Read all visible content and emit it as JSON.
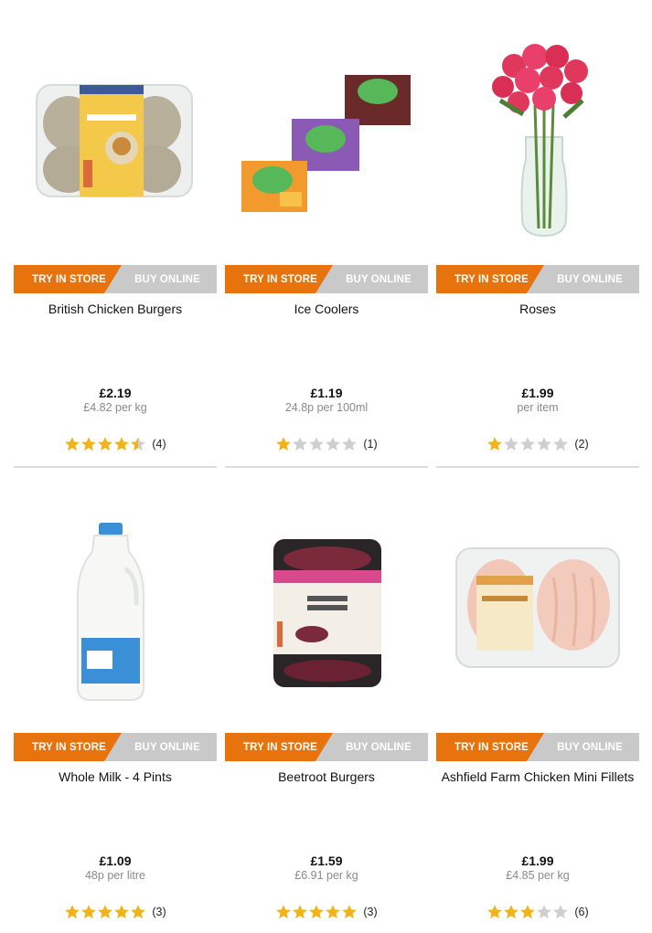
{
  "products": [
    {
      "name": "British Chicken Burgers",
      "price": "£2.19",
      "unit_price": "£4.82 per kg",
      "rating": 4.5,
      "reviews": "(4)",
      "image_icon": "chicken-burgers-pack-icon",
      "try_label": "TRY IN STORE",
      "buy_label": "BUY ONLINE"
    },
    {
      "name": "Ice Coolers",
      "price": "£1.19",
      "unit_price": "24.8p per 100ml",
      "rating": 1,
      "reviews": "(1)",
      "image_icon": "ice-coolers-boxes-icon",
      "try_label": "TRY IN STORE",
      "buy_label": "BUY ONLINE"
    },
    {
      "name": "Roses",
      "price": "£1.99",
      "unit_price": "per item",
      "rating": 1,
      "reviews": "(2)",
      "image_icon": "roses-vase-icon",
      "try_label": "TRY IN STORE",
      "buy_label": "BUY ONLINE"
    },
    {
      "name": "Whole Milk - 4 Pints",
      "price": "£1.09",
      "unit_price": "48p per litre",
      "rating": 5,
      "reviews": "(3)",
      "image_icon": "milk-bottle-icon",
      "try_label": "TRY IN STORE",
      "buy_label": "BUY ONLINE"
    },
    {
      "name": "Beetroot Burgers",
      "price": "£1.59",
      "unit_price": "£6.91 per kg",
      "rating": 5,
      "reviews": "(3)",
      "image_icon": "beetroot-burgers-pack-icon",
      "try_label": "TRY IN STORE",
      "buy_label": "BUY ONLINE"
    },
    {
      "name": "Ashfield Farm Chicken Mini Fillets",
      "price": "£1.99",
      "unit_price": "£4.85 per kg",
      "rating": 3,
      "reviews": "(6)",
      "image_icon": "chicken-fillets-pack-icon",
      "try_label": "TRY IN STORE",
      "buy_label": "BUY ONLINE"
    }
  ],
  "colors": {
    "try_in_store": "#e8730c",
    "buy_online": "#c9c9c9",
    "star_filled": "#f1b418",
    "star_empty": "#cfcfcf",
    "unit_text": "#8a8a8a"
  }
}
